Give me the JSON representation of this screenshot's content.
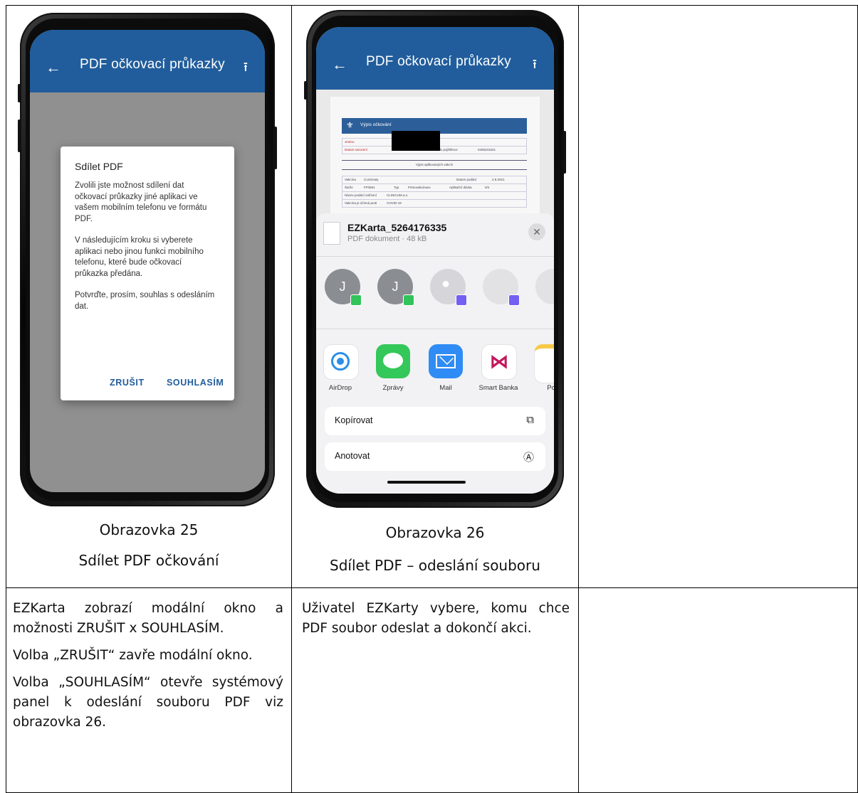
{
  "screen25": {
    "appbar": {
      "back_icon": "←",
      "title": "PDF očkovací průkazky",
      "share_icon": "⭱"
    },
    "dialog": {
      "title": "Sdílet PDF",
      "p1": "Zvolili jste možnost sdílení dat očkovací průkazky jiné aplikaci ve vašem mobilním telefonu ve formátu PDF.",
      "p2": "V následujícím kroku si vyberete aplikaci nebo jinou funkci mobilního telefonu, které bude očkovací průkazka předána.",
      "p3": "Potvrďte, prosím, souhlas s odesláním dat.",
      "cancel": "ZRUŠIT",
      "agree": "SOUHLASÍM"
    },
    "caption_title": "Obrazovka 25",
    "caption_sub": "Sdílet PDF očkování",
    "description": [
      "EZKarta zobrazí modální okno a možnosti ZRUŠIT x SOUHLASÍM.",
      "Volba „ZRUŠIT“ zavře modální okno.",
      "Volba „SOUHLASÍM“ otevře systémový panel k odeslání souboru PDF viz obrazovka 26."
    ]
  },
  "screen26": {
    "appbar": {
      "back_icon": "←",
      "title": "PDF očkovací průkazky",
      "share_icon": "⭱"
    },
    "doc": {
      "header": "Výpis očkování",
      "row_name": "Jméno",
      "row_birth": "Datum narození",
      "row_insurance": "Číslo pojištěnce",
      "insurance_value": "0405231521",
      "section": "Výpis aplikovaných vakcín",
      "vaccine": "Vakcína",
      "vaccine_value": "Comirnaty",
      "date_label": "Datum podání",
      "date_value": "2.9.2021",
      "batch": "Šarže",
      "batch_value": "FF0681",
      "type": "Typ",
      "type_value": "Primovakcinace",
      "dose": "Aplikační dávka",
      "dose_value": "0/4",
      "facility": "Název podání zařízení",
      "facility_value": "CLINICUM a.s.",
      "disease": "Vakcína je účinná proti",
      "disease_value": "COVID-19"
    },
    "share_sheet": {
      "file_name": "EZKarta_5264176335",
      "file_meta": "PDF dokument · 48 kB",
      "close_icon": "✕",
      "contacts": [
        {
          "initial": "J"
        },
        {
          "initial": "J"
        },
        {
          "initial": ""
        },
        {
          "initial": ""
        },
        {
          "initial": ""
        }
      ],
      "apps": [
        "AirDrop",
        "Zprávy",
        "Mail",
        "Smart Banka",
        "Po"
      ],
      "actions": [
        {
          "label": "Kopírovat",
          "icon": "⧉"
        },
        {
          "label": "Anotovat",
          "icon": "Ⓐ"
        }
      ]
    },
    "caption_title": "Obrazovka 26",
    "caption_sub": "Sdílet PDF – odeslání souboru",
    "description": [
      "Uživatel EZKarty vybere, komu chce PDF soubor odeslat a dokončí akci."
    ]
  },
  "colors": {
    "appbar": "#215d9c",
    "dialog_button": "#215d9c"
  }
}
